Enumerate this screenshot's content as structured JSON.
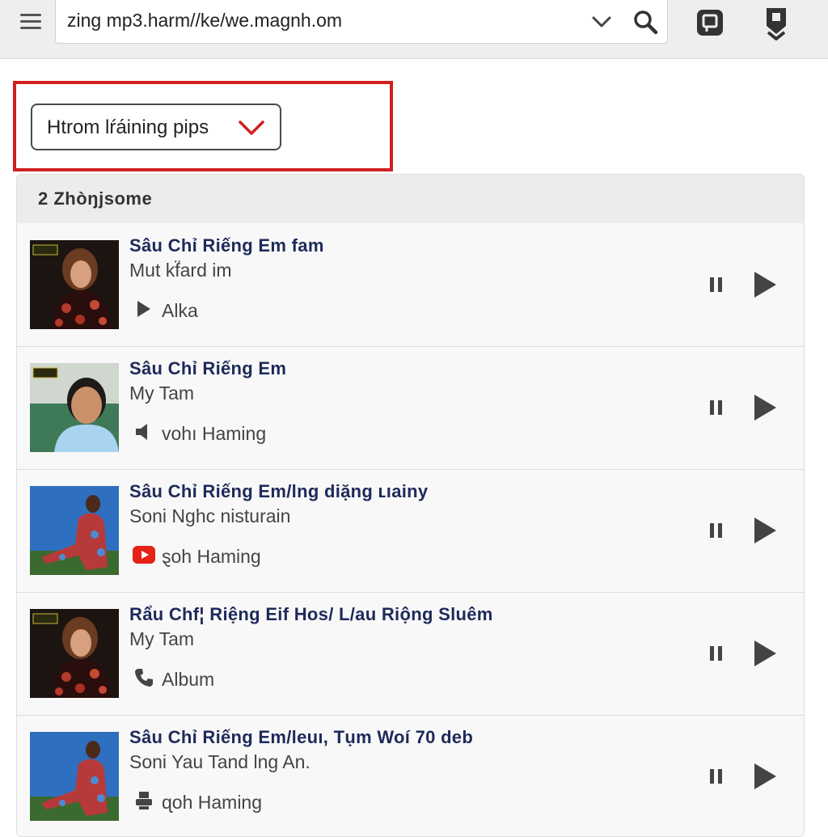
{
  "browser": {
    "url": "zing mp3.harm//ke/we.magnh.om",
    "menu_icon": "hamburger-menu-icon",
    "dropdown_icon": "chevron-down-icon",
    "search_icon": "search-icon"
  },
  "filter": {
    "label": "Htrom lŕáining pips",
    "chevron_color": "#d11f1f"
  },
  "list": {
    "header": "2  Zhòŋjsome",
    "items": [
      {
        "title": "Sâu Chỉ Riếng Em fam",
        "artist": "Mut kf̈ard im",
        "source_icon": "play-triangle-icon",
        "source": "Alka"
      },
      {
        "title": "Sâu Chỉ Riếng Em",
        "artist": "My Tam",
        "source_icon": "speaker-icon",
        "source": "vohı Haming"
      },
      {
        "title": "Sâu Chỉ Riếng Em/lng diặng ʟıainy",
        "artist": "Soni Nghc nisturain",
        "source_icon": "youtube-icon",
        "source": "ȿoh Haming"
      },
      {
        "title": "Rẩu Chf¦ Riệng Eif Hos/ L/au Riộng Sluêm",
        "artist": "My Tam",
        "source_icon": "phone-icon",
        "source": "Album"
      },
      {
        "title": "Sâu Chỉ Riếng Em/leuı, Tụm Woí 70 deb",
        "artist": "Soni Yau Tand lng An.",
        "source_icon": "printer-icon",
        "source": "ɋoh Haming"
      }
    ]
  },
  "colors": {
    "accent_red": "#d11f1f",
    "title_navy": "#1e2a5a",
    "youtube_red": "#e62117"
  }
}
